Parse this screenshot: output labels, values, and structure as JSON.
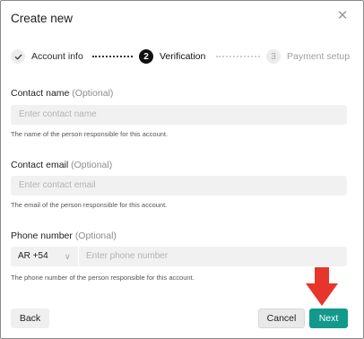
{
  "dialog": {
    "title": "Create new",
    "close_icon": "close-icon"
  },
  "steps": [
    {
      "label": "Account info",
      "marker": "",
      "state": "done"
    },
    {
      "label": "Verification",
      "marker": "2",
      "state": "active"
    },
    {
      "label": "Payment setup",
      "marker": "3",
      "state": "todo"
    }
  ],
  "form": {
    "contact_name": {
      "label": "Contact name",
      "optional": "(Optional)",
      "placeholder": "Enter contact name",
      "help": "The name of the person responsible for this account."
    },
    "contact_email": {
      "label": "Contact email",
      "optional": "(Optional)",
      "placeholder": "Enter contact email",
      "help": "The email of the person responsible for this account."
    },
    "phone_number": {
      "label": "Phone number",
      "optional": "(Optional)",
      "country_code": "AR +54",
      "placeholder": "Enter phone number",
      "help": "The phone number of the person responsible for this account."
    }
  },
  "footer": {
    "back_label": "Back",
    "cancel_label": "Cancel",
    "next_label": "Next"
  },
  "colors": {
    "primary": "#12998c",
    "annotation_arrow": "#e8352b"
  }
}
